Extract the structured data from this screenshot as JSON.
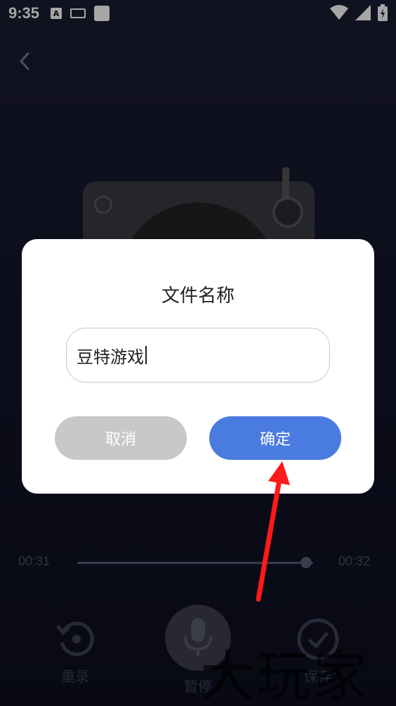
{
  "status_bar": {
    "time": "9:35",
    "icons": [
      "accessibility-a-icon",
      "keyboard-icon",
      "square-icon",
      "wifi-icon",
      "signal-icon",
      "battery-icon"
    ]
  },
  "nav": {
    "back_icon": "chevron-left-icon"
  },
  "player": {
    "current_time": "00:31",
    "total_time": "00:32",
    "progress_fraction": 0.97,
    "controls": [
      {
        "label": "重录",
        "icon": "re-record-icon"
      },
      {
        "label": "暂停",
        "icon": "microphone-icon"
      },
      {
        "label": "保存",
        "icon": "check-circle-icon"
      }
    ]
  },
  "dialog": {
    "title": "文件名称",
    "input_value": "豆特游戏",
    "cancel_label": "取消",
    "confirm_label": "确定"
  },
  "watermark": "大玩家",
  "colors": {
    "background": "#15172c",
    "dialog_bg": "#ffffff",
    "confirm_button": "#4a7be0",
    "cancel_button": "#c8c8ca",
    "annotation_arrow": "#ff1a1a"
  }
}
